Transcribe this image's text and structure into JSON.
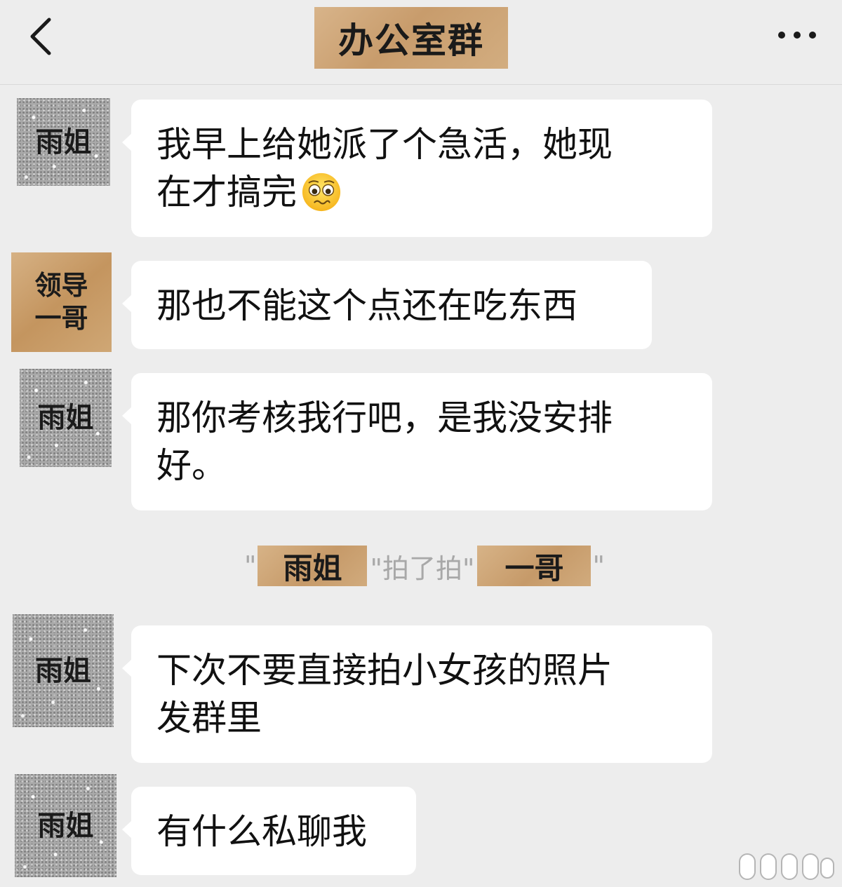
{
  "header": {
    "title": "办公室群",
    "back_icon": "chevron-left-icon",
    "more_icon": "ellipsis-icon"
  },
  "messages": [
    {
      "sender": "雨姐",
      "avatar_style": "glitter",
      "text_lines": [
        "我早上给她派了个急活，她现",
        "在才搞完"
      ],
      "emoji": "pleading-face-emoji"
    },
    {
      "sender_lines": [
        "领导",
        "一哥"
      ],
      "avatar_style": "kraft-paper",
      "text_lines": [
        "那也不能这个点还在吃东西"
      ]
    },
    {
      "sender": "雨姐",
      "avatar_style": "glitter",
      "text_lines": [
        "那你考核我行吧，是我没安排",
        "好。"
      ]
    },
    {
      "sender": "雨姐",
      "avatar_style": "glitter",
      "text_lines": [
        "下次不要直接拍小女孩的照片",
        "发群里"
      ]
    },
    {
      "sender": "雨姐",
      "avatar_style": "glitter",
      "text_lines": [
        "有什么私聊我"
      ]
    }
  ],
  "system_notice": {
    "open_quote": "\"",
    "actor": "雨姐",
    "action": "\"拍了拍\"",
    "target": "一哥",
    "close_quote": "\""
  },
  "colors": {
    "background": "#ededed",
    "bubble": "#ffffff",
    "kraft_tag": "#c89c6c",
    "system_text": "#a8a8a8"
  }
}
